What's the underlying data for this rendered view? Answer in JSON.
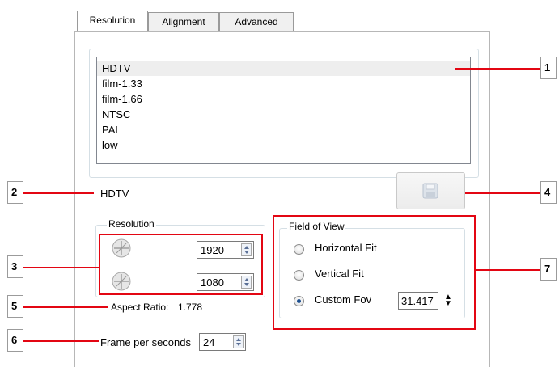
{
  "tabs": [
    {
      "label": "Resolution",
      "active": true
    },
    {
      "label": "Alignment",
      "active": false
    },
    {
      "label": "Advanced",
      "active": false
    }
  ],
  "presets": {
    "items": [
      "HDTV",
      "film-1.33",
      "film-1.66",
      "NTSC",
      "PAL",
      "low"
    ],
    "selected": "HDTV"
  },
  "current_preset": "HDTV",
  "resolution": {
    "legend": "Resolution",
    "width": "1920",
    "height": "1080",
    "aspect_label": "Aspect Ratio:",
    "aspect_value": "1.778"
  },
  "fov": {
    "legend": "Field of View",
    "options": [
      "Horizontal Fit",
      "Vertical Fit",
      "Custom Fov"
    ],
    "selected": "Custom Fov",
    "custom_value": "31.417"
  },
  "frame": {
    "label": "Frame per seconds",
    "value": "24"
  },
  "callouts": [
    "1",
    "2",
    "3",
    "4",
    "5",
    "6",
    "7"
  ],
  "colors": {
    "callout_red": "#e30613",
    "selection": "#eeeeee"
  },
  "icons": {
    "save": "floppy-disk-icon",
    "link": "crosshair-link-icon"
  }
}
